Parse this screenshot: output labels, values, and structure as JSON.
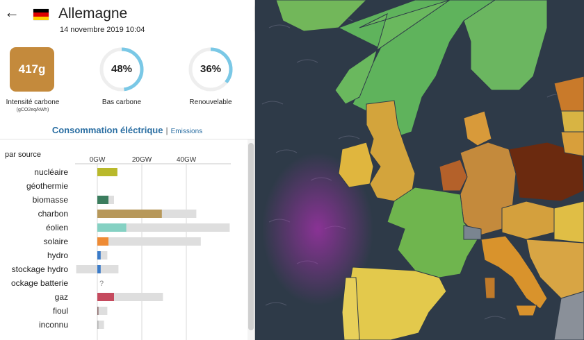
{
  "header": {
    "country": "Allemagne",
    "datetime": "14 novembre 2019 10:04",
    "flag_colors": [
      "#000000",
      "#dd0000",
      "#ffce00"
    ]
  },
  "stats": {
    "carbon_intensity": {
      "value": "417g",
      "label": "Intensité carbone",
      "unit": "(gCO2eq/kWh)",
      "color": "#c48a3c"
    },
    "low_carbon": {
      "value": "48%",
      "fraction": 0.48,
      "label": "Bas carbone"
    },
    "renewable": {
      "value": "36%",
      "fraction": 0.36,
      "label": "Renouvelable"
    },
    "gauge_color": "#7ac8e6"
  },
  "tabs": {
    "active": "Consommation éléctrique",
    "separator": "|",
    "other": "Emissions"
  },
  "chart_data": {
    "type": "bar",
    "title": "par source",
    "x_ticks": [
      "0GW",
      "20GW",
      "40GW"
    ],
    "xlim": [
      -10,
      60
    ],
    "unit": "GW",
    "categories": [
      "nucléaire",
      "géothermie",
      "biomasse",
      "charbon",
      "éolien",
      "solaire",
      "hydro",
      "stockage hydro",
      "ockage batterie",
      "gaz",
      "fioul",
      "inconnu"
    ],
    "series": [
      {
        "role": "production",
        "values": [
          9,
          null,
          5,
          29,
          13,
          5,
          1.5,
          1.5,
          null,
          7.5,
          0.5,
          0.5
        ]
      },
      {
        "role": "capacity",
        "values": [
          9,
          null,
          7.5,
          44.5,
          59.5,
          46.5,
          4.5,
          9.5,
          null,
          29.5,
          4.5,
          3
        ]
      }
    ],
    "capacity_min": [
      0,
      null,
      0,
      0,
      0,
      0,
      0,
      -9.5,
      null,
      0,
      0,
      0
    ],
    "colors": [
      "#b9b92b",
      "#a95e4b",
      "#3b7d5e",
      "#b7985a",
      "#85d1c3",
      "#ee8b35",
      "#3a7bc9",
      "#3a7bc9",
      "#7a7a9a",
      "#c54a5e",
      "#8b6b6b",
      "#b2b2b2"
    ],
    "unknown_marker": "?",
    "unknown_index": 8
  },
  "map": {
    "background": "#2e3a48"
  }
}
